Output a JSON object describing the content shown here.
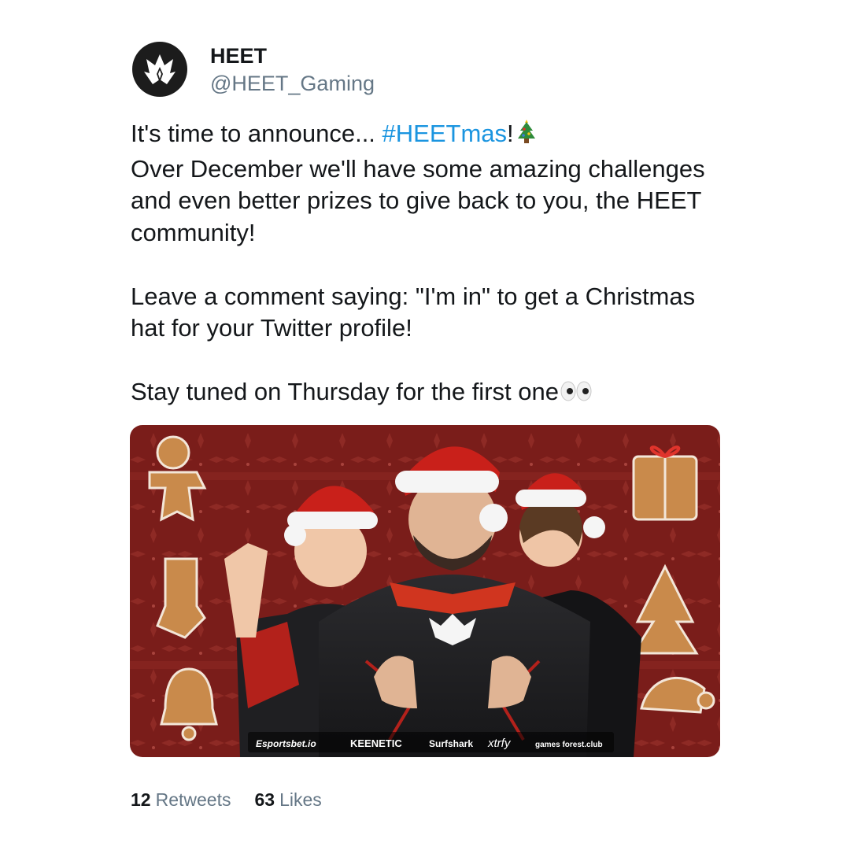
{
  "user": {
    "display_name": "HEET",
    "handle": "@HEET_Gaming",
    "avatar_icon": "heet-crown-logo"
  },
  "tweet": {
    "line1_prefix": "It's time to announce... ",
    "hashtag": "#HEETmas",
    "line1_suffix": "!",
    "line1_emoji": "christmas-tree-emoji",
    "para1_rest": "Over December we'll have some amazing challenges and even better prizes to give back to you, the HEET community!",
    "para2": "Leave a comment saying: \"I'm in\" to get a Christmas hat for your Twitter profile!",
    "para3": "Stay tuned on Thursday for the first one",
    "para3_emoji": "eyes-emoji"
  },
  "media": {
    "description_icons": [
      "gingerbread-man-icon",
      "gift-box-icon",
      "stocking-icon",
      "christmas-tree-cookie-icon",
      "bell-cookie-icon",
      "santa-hat-cookie-icon"
    ],
    "sponsors": [
      "Esportsbet.io",
      "KEENETIC",
      "Surfshark",
      "xtrfy",
      "games forest.club"
    ]
  },
  "stats": {
    "retweets_count": "12",
    "retweets_label": "Retweets",
    "likes_count": "63",
    "likes_label": "Likes"
  },
  "colors": {
    "hashtag": "#1b95e0",
    "secondary_text": "#657786",
    "primary_text": "#14171a",
    "media_bg": "#7a1d1a"
  }
}
